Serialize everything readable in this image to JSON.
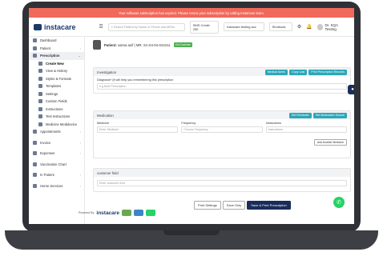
{
  "banner": "Your software subscription has expired. Please renew your subscription by calling InstaCare team.",
  "logo": "instacare",
  "search_placeholder": "Search Patient by Name or Phone and MRno",
  "sms_credit": "SMS Credit: 250",
  "clinic_select": "Instacare testing acc",
  "shortcuts": "Shortcuts",
  "user_name": "Dr. SQA Testing",
  "sidebar": {
    "dashboard": "Dashboard",
    "patient": "Patient",
    "prescription": "Prescription",
    "sub": [
      "Create New",
      "View & History",
      "Styles & Formats",
      "Templates",
      "Settings",
      "Custom Fields",
      "Instructions",
      "Test Instructions",
      "Medicine Medidevice"
    ],
    "appointments": "Appointments",
    "invoice": "Invoice",
    "expenses": "Expenses",
    "vaccination": "Vaccination Chart",
    "inpatient": "In Patient",
    "home_services": "Home Services"
  },
  "patient": {
    "label": "Patient:",
    "name": "saima asif",
    "mr": "MR: SA-04-04-041011",
    "tag": "Old Customer"
  },
  "investigation": {
    "title": "Investigation",
    "btn_medical": "Medical Alerts",
    "btn_copy": "Copy Last",
    "btn_print": "Print Prescription Records",
    "diag_label": "Diagnosis* (It will help you remembering this prescription",
    "diag_placeholder": "e.g Brief Prescription"
  },
  "medication": {
    "title": "Medication",
    "btn_reminder": "Set Reminder",
    "btn_source": "Set Medication Source",
    "col_medicine": "Medicine",
    "col_frequency": "Frequency",
    "col_instructions": "Instructions",
    "ph_medicine": "Enter Medicine",
    "ph_frequency": "Choose Frequency",
    "ph_instructions": "Instructions",
    "add_btn": "Add Another Medicine"
  },
  "custom": {
    "title": "customer field",
    "placeholder": "Enter customer field"
  },
  "footer": {
    "print_settings": "Print Settings",
    "save_only": "Save Only",
    "save_print": "Save & Print Prescription"
  },
  "powered_by": "Powered By",
  "powered_logo": "instacare"
}
